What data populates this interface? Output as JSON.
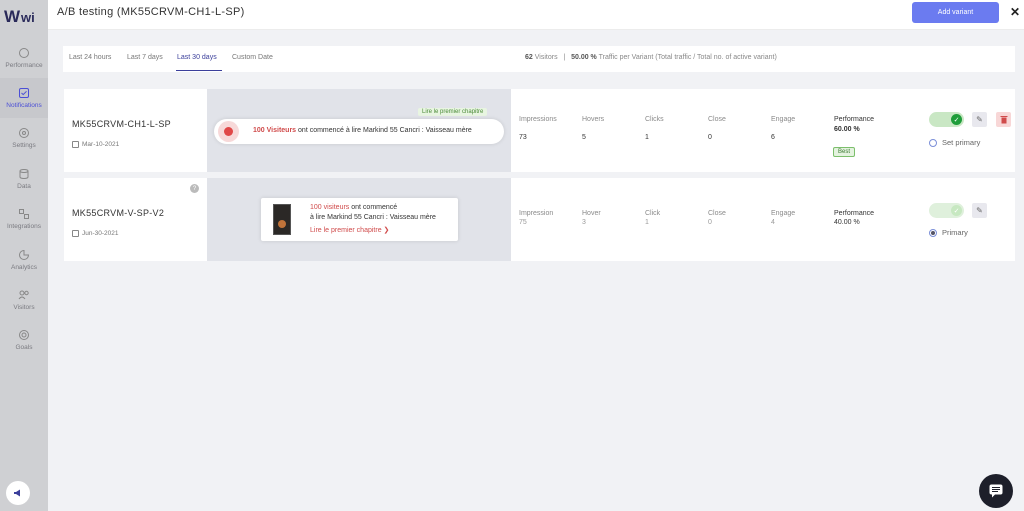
{
  "brand": {
    "logo_text": "wi"
  },
  "sidebar": {
    "items": [
      {
        "label": "Performance",
        "icon": "performance-icon"
      },
      {
        "label": "Notifications",
        "icon": "notifications-icon",
        "active": true
      },
      {
        "label": "Settings",
        "icon": "settings-icon"
      },
      {
        "label": "Data",
        "icon": "data-icon"
      },
      {
        "label": "Integrations",
        "icon": "integrations-icon"
      },
      {
        "label": "Analytics",
        "icon": "analytics-icon"
      },
      {
        "label": "Visitors",
        "icon": "visitors-icon"
      },
      {
        "label": "Goals",
        "icon": "goals-icon"
      }
    ]
  },
  "header": {
    "title": "A/B testing (MK55CRVM-CH1-L-SP)",
    "add_variant": "Add variant",
    "close": "✕"
  },
  "filters": {
    "items": [
      "Last 24 hours",
      "Last 7 days",
      "Last 30 days",
      "Custom Date"
    ],
    "active_index": 2,
    "visitors_count": "62",
    "visitors_label": "Visitors",
    "sep": "|",
    "traffic_pct": "50.00 %",
    "traffic_label": "Traffic per Variant (Total traffic / Total no. of active variant)"
  },
  "variants": [
    {
      "name": "MK55CRVM-CH1-L-SP",
      "date": "Mar-10-2021",
      "preview": {
        "tag": "Lire le premier chapitre",
        "highlight": "100 Visiteurs",
        "text": "ont commencé à lire Markind 55 Cancri : Vaisseau mère"
      },
      "metrics": {
        "impressions_label": "Impressions",
        "impressions": "73",
        "hovers_label": "Hovers",
        "hovers": "5",
        "clicks_label": "Clicks",
        "clicks": "1",
        "close_label": "Close",
        "close": "0",
        "engage_label": "Engage",
        "engage": "6",
        "performance_label": "Performance",
        "performance": "60.00 %"
      },
      "badge": "Best",
      "primary_label": "Set primary"
    },
    {
      "name": "MK55CRVM-V-SP-V2",
      "date": "Jun-30-2021",
      "help": "?",
      "preview": {
        "highlight": "100 visiteurs",
        "text1": "ont commencé",
        "text2": "à lire Markind 55 Cancri : Vaisseau mère",
        "link": "Lire le premier chapitre",
        "link_arrow": "❯"
      },
      "metrics": {
        "impressions_label": "Impression",
        "impressions": "75",
        "hovers_label": "Hover",
        "hovers": "3",
        "clicks_label": "Click",
        "clicks": "1",
        "close_label": "Close",
        "close": "0",
        "engage_label": "Engage",
        "engage": "4",
        "performance_label": "Performance",
        "performance": "40.00 %"
      },
      "primary_label": "Primary"
    }
  ],
  "colors": {
    "accent": "#6b7bf0",
    "danger": "#d04b4b",
    "success": "#1f9d3a"
  }
}
